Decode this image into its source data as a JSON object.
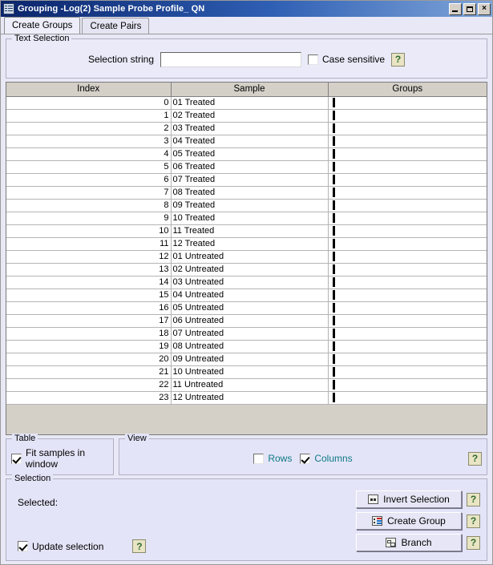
{
  "window": {
    "title": "Grouping -Log(2) Sample Probe Profile_ QN",
    "icon": "list-grid-icon",
    "controls": {
      "minimize": "minimize-icon",
      "maximize": "maximize-icon",
      "close": "×"
    }
  },
  "tabs": [
    {
      "label": "Create Groups",
      "active": true
    },
    {
      "label": "Create Pairs",
      "active": false
    }
  ],
  "text_selection": {
    "legend": "Text Selection",
    "selection_string_label": "Selection string",
    "selection_string_value": "",
    "selection_string_placeholder": "",
    "case_sensitive_label": "Case sensitive",
    "case_sensitive_checked": false,
    "help_label": "?"
  },
  "table": {
    "columns": [
      "Index",
      "Sample",
      "Groups"
    ],
    "rows": [
      {
        "index": "0",
        "sample": "01 Treated",
        "groups": ""
      },
      {
        "index": "1",
        "sample": "02 Treated",
        "groups": ""
      },
      {
        "index": "2",
        "sample": "03 Treated",
        "groups": ""
      },
      {
        "index": "3",
        "sample": "04 Treated",
        "groups": ""
      },
      {
        "index": "4",
        "sample": "05 Treated",
        "groups": ""
      },
      {
        "index": "5",
        "sample": "06 Treated",
        "groups": ""
      },
      {
        "index": "6",
        "sample": "07 Treated",
        "groups": ""
      },
      {
        "index": "7",
        "sample": "08 Treated",
        "groups": ""
      },
      {
        "index": "8",
        "sample": "09 Treated",
        "groups": ""
      },
      {
        "index": "9",
        "sample": "10 Treated",
        "groups": ""
      },
      {
        "index": "10",
        "sample": "11 Treated",
        "groups": ""
      },
      {
        "index": "11",
        "sample": "12 Treated",
        "groups": ""
      },
      {
        "index": "12",
        "sample": "01 Untreated",
        "groups": ""
      },
      {
        "index": "13",
        "sample": "02 Untreated",
        "groups": ""
      },
      {
        "index": "14",
        "sample": "03 Untreated",
        "groups": ""
      },
      {
        "index": "15",
        "sample": "04 Untreated",
        "groups": ""
      },
      {
        "index": "16",
        "sample": "05 Untreated",
        "groups": ""
      },
      {
        "index": "17",
        "sample": "06 Untreated",
        "groups": ""
      },
      {
        "index": "18",
        "sample": "07 Untreated",
        "groups": ""
      },
      {
        "index": "19",
        "sample": "08 Untreated",
        "groups": ""
      },
      {
        "index": "20",
        "sample": "09 Untreated",
        "groups": ""
      },
      {
        "index": "21",
        "sample": "10 Untreated",
        "groups": ""
      },
      {
        "index": "22",
        "sample": "11 Untreated",
        "groups": ""
      },
      {
        "index": "23",
        "sample": "12 Untreated",
        "groups": ""
      }
    ]
  },
  "table_panel": {
    "legend": "Table",
    "fit_samples_label": "Fit samples in window",
    "fit_samples_checked": true
  },
  "view_panel": {
    "legend": "View",
    "rows_label": "Rows",
    "rows_checked": false,
    "columns_label": "Columns",
    "columns_checked": true,
    "help_label": "?"
  },
  "selection_panel": {
    "legend": "Selection",
    "selected_label": "Selected:",
    "selected_value": "",
    "update_selection_label": "Update selection",
    "update_selection_checked": true,
    "update_help_label": "?",
    "buttons": [
      {
        "label": "Invert Selection",
        "icon": "invert-selection-icon",
        "help": "?"
      },
      {
        "label": "Create Group",
        "icon": "create-group-icon",
        "help": "?"
      },
      {
        "label": "Branch",
        "icon": "branch-icon",
        "help": "?"
      }
    ]
  },
  "colors": {
    "titlebar_start": "#0a246a",
    "titlebar_end": "#7fa5d8",
    "panel_bg": "#e4e4f8",
    "window_bg": "#e8e8f6",
    "header_bg": "#d4d0c8",
    "help_bg": "#e8e4c4",
    "help_fg": "#2f6b2f",
    "teal_text": "#0d7a84"
  }
}
